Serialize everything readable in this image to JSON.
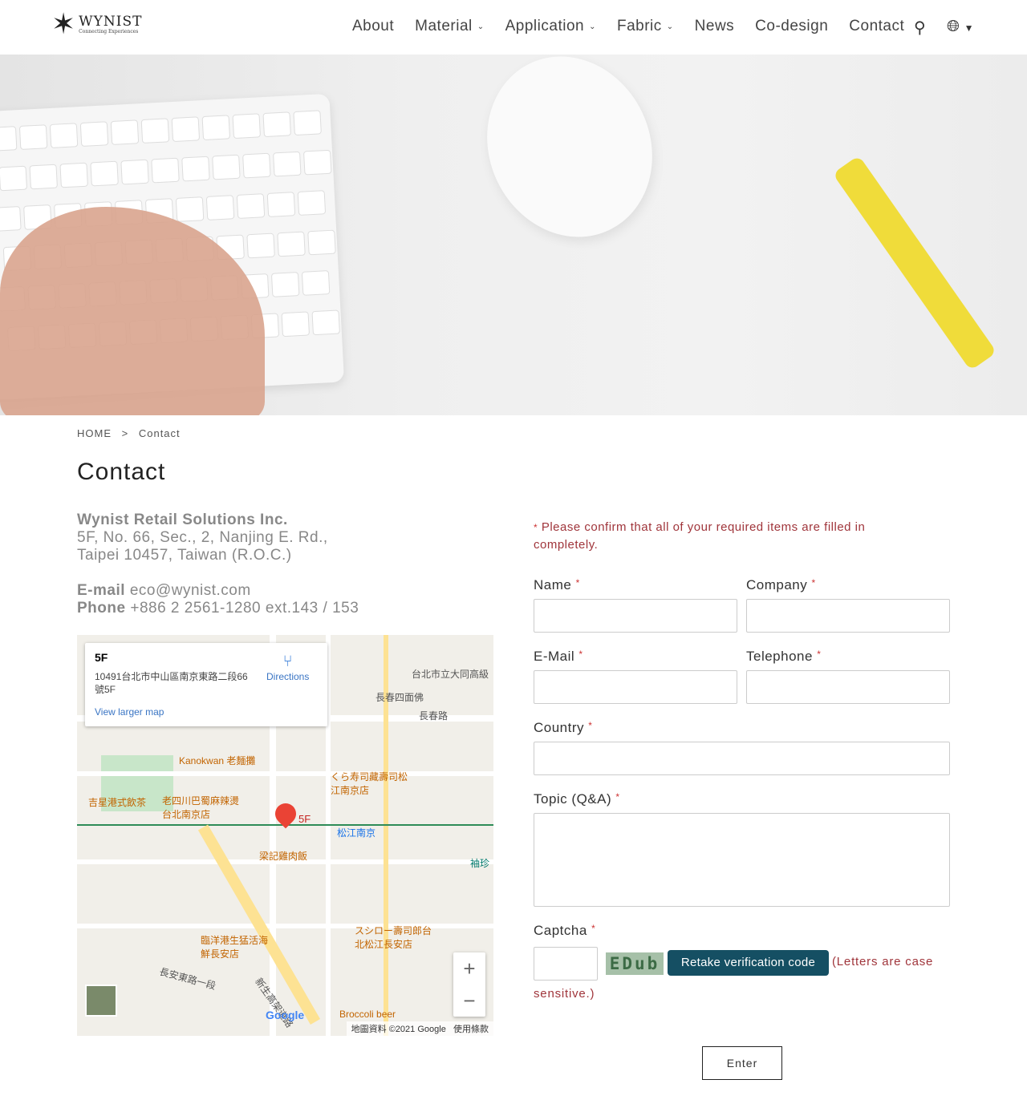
{
  "header": {
    "logo_name": "WYNIST",
    "logo_tagline": "Connecting Experiences",
    "nav": [
      {
        "label": "About",
        "dropdown": false
      },
      {
        "label": "Material",
        "dropdown": true
      },
      {
        "label": "Application",
        "dropdown": true
      },
      {
        "label": "Fabric",
        "dropdown": true
      },
      {
        "label": "News",
        "dropdown": false
      },
      {
        "label": "Co-design",
        "dropdown": false
      },
      {
        "label": "Contact",
        "dropdown": false
      }
    ],
    "search_icon": "search-icon",
    "language_icon": "globe-icon"
  },
  "breadcrumb": {
    "home": "HOME",
    "separator": ">",
    "current": "Contact"
  },
  "page_title": "Contact",
  "company": {
    "name": "Wynist Retail Solutions Inc.",
    "address_line1": "5F, No. 66, Sec., 2, Nanjing E. Rd.,",
    "address_line2": "Taipei 10457, Taiwan (R.O.C.)",
    "email_label": "E-mail",
    "email": "eco@wynist.com",
    "phone_label": "Phone",
    "phone": "+886 2 2561-1280 ext.143 / 153"
  },
  "map": {
    "card_title": "5F",
    "card_address": "10491台北市中山區南京東路二段66號5F",
    "directions": "Directions",
    "view_larger": "View larger map",
    "pin_label": "5F",
    "labels": [
      "Kanokwan 老麵攤",
      "吉星港式飲茶",
      "老四川巴蜀麻辣燙台北南京店",
      "くら寿司藏壽司松江南京店",
      "松江南京",
      "梁記雞肉飯",
      "臨洋港生猛活海鮮長安店",
      "スシロー壽司郎台北松江長安店",
      "長安東路一段",
      "長春四面佛",
      "長春路",
      "台北市立大同高級",
      "袖珍",
      "Broccoli beer",
      "新生高架道路"
    ],
    "attribution": "地圖資料 ©2021 Google",
    "terms": "使用條款",
    "google": "Google",
    "zoom_in": "+",
    "zoom_out": "−"
  },
  "form": {
    "warning": "Please confirm that all of your required items are filled in completely.",
    "required_mark": "*",
    "name_label": "Name",
    "company_label": "Company",
    "email_label": "E-Mail",
    "telephone_label": "Telephone",
    "country_label": "Country",
    "topic_label": "Topic (Q&A)",
    "captcha_label": "Captcha",
    "captcha_code": "EDub",
    "retake_button": "Retake verification code",
    "case_note": "(Letters are case",
    "case_note2": "sensitive.)",
    "submit": "Enter",
    "accent_color": "#154f63",
    "warning_color": "#a0353b"
  }
}
